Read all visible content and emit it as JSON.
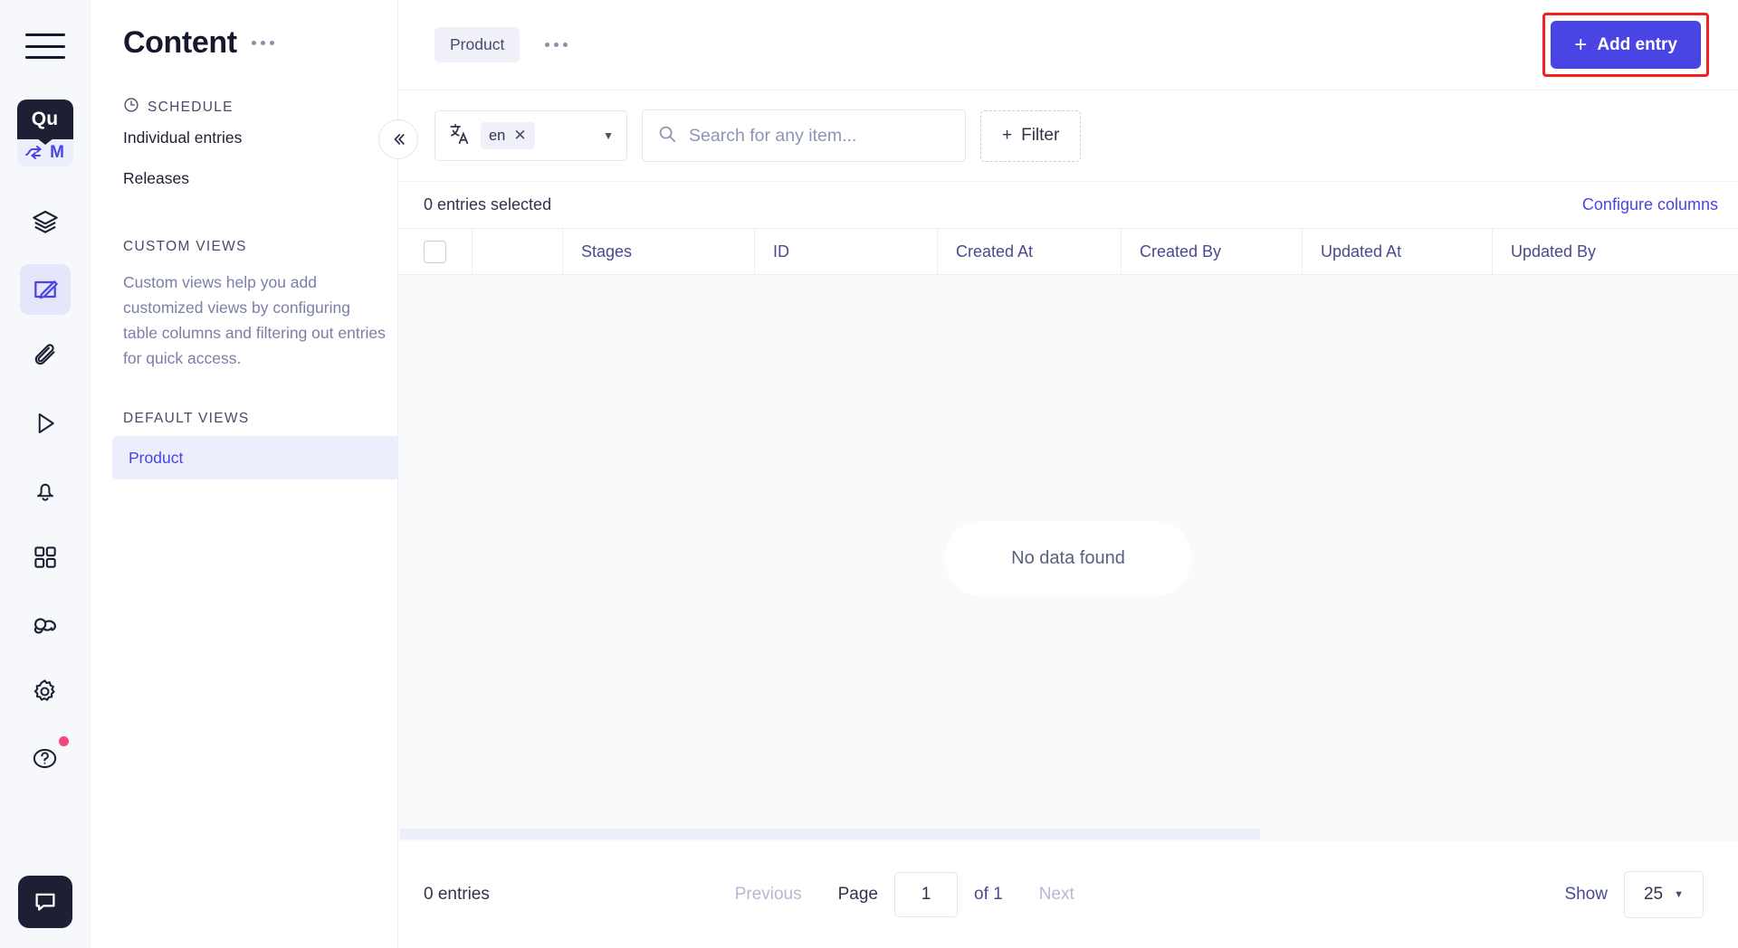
{
  "rail": {
    "menu_icon": "hamburger-menu-icon",
    "logo": {
      "top_text": "Qu",
      "bottom_text": "M"
    },
    "icons": [
      {
        "name": "content-type-builder-icon",
        "label": "Content-Type Builder"
      },
      {
        "name": "content-manager-icon",
        "label": "Content Manager"
      },
      {
        "name": "media-library-icon",
        "label": "Media Library"
      },
      {
        "name": "play-icon",
        "label": "Preview"
      },
      {
        "name": "bell-icon",
        "label": "Notifications"
      },
      {
        "name": "apps-grid-icon",
        "label": "Marketplace"
      },
      {
        "name": "webhooks-icon",
        "label": "Webhooks"
      },
      {
        "name": "gear-icon",
        "label": "Settings"
      },
      {
        "name": "help-circle-icon",
        "label": "Help"
      }
    ],
    "chat_icon": "chat-bubble-icon"
  },
  "sidebar": {
    "title": "Content",
    "more_icon": "more-options-icon",
    "schedule": {
      "icon": "clock-icon",
      "label": "SCHEDULE",
      "items": [
        {
          "label": "Individual entries"
        },
        {
          "label": "Releases"
        }
      ]
    },
    "custom_views": {
      "label": "CUSTOM VIEWS",
      "description": "Custom views help you add customized views by configuring table columns and filtering out entries for quick access."
    },
    "default_views": {
      "label": "DEFAULT VIEWS",
      "items": [
        {
          "label": "Product",
          "selected": true
        }
      ]
    }
  },
  "topbar": {
    "chip_label": "Product",
    "more_icon": "more-options-icon",
    "add_entry": {
      "plus": "+",
      "label": "Add entry",
      "highlight_color": "#f42020"
    }
  },
  "filterbar": {
    "collapse_icon": "chevron-double-left-icon",
    "locale": {
      "icon": "translate-icon",
      "tag": "en",
      "remove_icon": "close-icon",
      "caret_icon": "chevron-down-icon"
    },
    "search": {
      "icon": "search-icon",
      "placeholder": "Search for any item...",
      "value": ""
    },
    "filter": {
      "plus": "+",
      "label": "Filter",
      "icon": "plus-icon"
    }
  },
  "table": {
    "selection_text": "0 entries selected",
    "configure_columns": "Configure columns",
    "columns": [
      {
        "key": "checkbox",
        "label": ""
      },
      {
        "key": "spacer",
        "label": ""
      },
      {
        "key": "stages",
        "label": "Stages"
      },
      {
        "key": "id",
        "label": "ID"
      },
      {
        "key": "created_at",
        "label": "Created At"
      },
      {
        "key": "created_by",
        "label": "Created By"
      },
      {
        "key": "updated_at",
        "label": "Updated At"
      },
      {
        "key": "updated_by",
        "label": "Updated By"
      }
    ],
    "rows": [],
    "empty_message": "No data found"
  },
  "pagination": {
    "entries_count": "0 entries",
    "previous": "Previous",
    "page_label": "Page",
    "page_value": "1",
    "of_label": "of 1",
    "next": "Next",
    "show_label": "Show",
    "show_value": "25"
  },
  "colors": {
    "accent": "#4945e4",
    "dark": "#1d2035",
    "highlight": "#f42020",
    "notification_dot": "#f5457f"
  }
}
